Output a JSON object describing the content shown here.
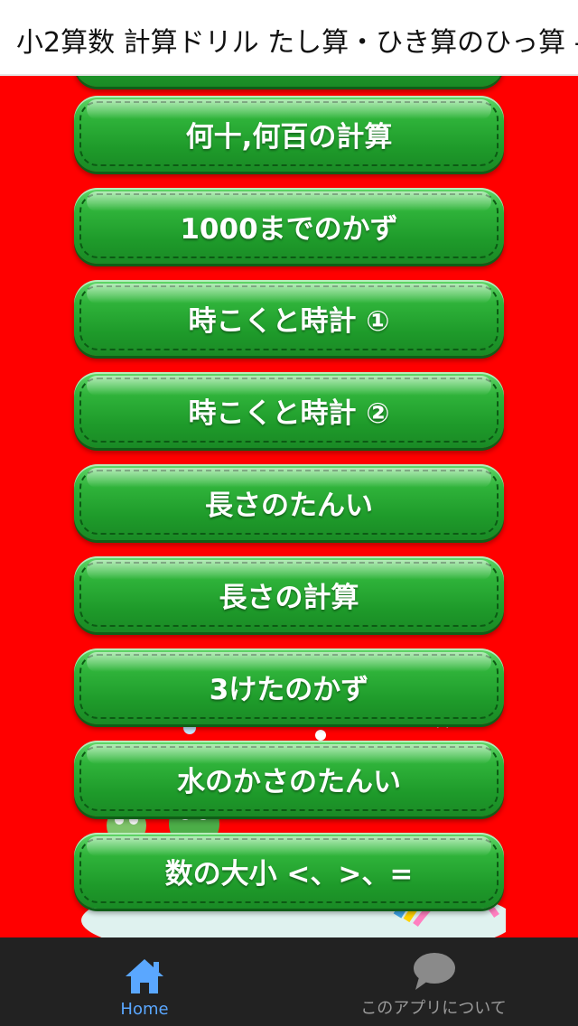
{
  "app": {
    "title": "小2算数 計算ドリル たし算・ひき算のひっ算 -"
  },
  "menu": {
    "items": [
      {
        "label": "何十,何百の計算"
      },
      {
        "label": "1000までのかず"
      },
      {
        "label": "時こくと時計 ①"
      },
      {
        "label": "時こくと時計 ②"
      },
      {
        "label": "長さのたんい"
      },
      {
        "label": "長さの計算"
      },
      {
        "label": "3けたのかず"
      },
      {
        "label": "水のかさのたんい"
      },
      {
        "label": "数の大小 <、>、="
      }
    ]
  },
  "bottom_nav": {
    "home_label": "Home",
    "about_label": "このアプリについて",
    "home_icon": "home-icon",
    "about_icon": "speech-bubble-icon",
    "active_color": "#5aa7ff",
    "inactive_color": "#9a9a9a"
  },
  "colors": {
    "background": "#ff0000",
    "button_green": "#1e9a2a",
    "nav_background": "#222222"
  }
}
